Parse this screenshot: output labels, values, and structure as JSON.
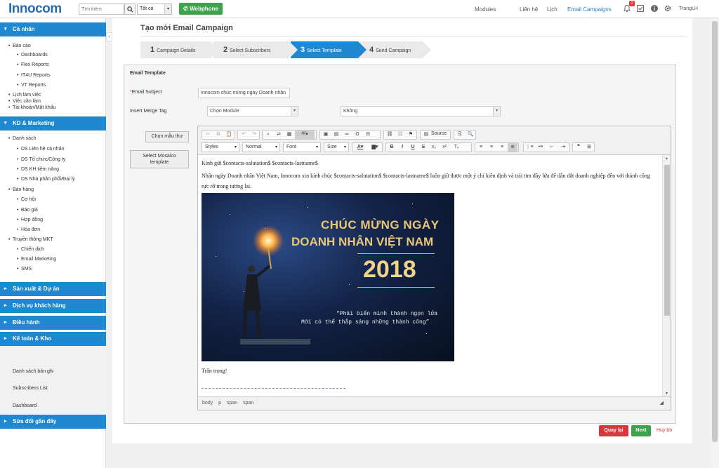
{
  "topbar": {
    "logo": "Innocom",
    "search_placeholder": "Tìm kiếm",
    "scope": "Tất cả",
    "webphone": "Webphone",
    "nav": [
      "Modules",
      "Liên hệ",
      "Lịch",
      "Email Campaigns"
    ],
    "notification_count": "2",
    "username": "TrangLH"
  },
  "sidebar": {
    "sections": [
      "Cá nhân",
      "KD & Marketing",
      "Sản xuất & Dự án",
      "Dịch vụ khách hàng",
      "Điều hành",
      "Kế toán & Kho",
      "Sửa đổi gần đây"
    ],
    "canhan": {
      "baocao": "Báo cáo",
      "reports": [
        "Dashboards",
        "Flex Reports",
        "IT4U Reports",
        "VT Reports"
      ],
      "others": [
        "Lịch làm việc",
        "Việc cần làm",
        "Tài khoản/Mật khẩu"
      ]
    },
    "kd": {
      "danhsach": "Danh sách",
      "danhsach_items": [
        "DS Liên hệ cá nhân",
        "DS Tổ chức/Công ty",
        "DS KH tiềm năng",
        "DS Nhà phân phối/Đại lý"
      ],
      "banhang": "Bán hàng",
      "banhang_items": [
        "Cơ hội",
        "Báo giá",
        "Hợp đồng",
        "Hóa đơn"
      ],
      "truyenthong": "Truyền thông MKT",
      "truyenthong_items": [
        "Chiến dịch",
        "Email Marketing",
        "SMS"
      ]
    },
    "links": [
      "Danh sách bản ghi",
      "Subscribers List",
      "Dashboard"
    ]
  },
  "main": {
    "title": "Tạo mới Email Campaign",
    "steps": [
      {
        "num": "1",
        "label": "Campaign Details"
      },
      {
        "num": "2",
        "label": "Select Subscribers"
      },
      {
        "num": "3",
        "label": "Select Template"
      },
      {
        "num": "4",
        "label": "Send Campaign"
      }
    ],
    "section_label": "Email Template",
    "subject_label": "Email Subject",
    "subject_value": "Innocom chúc mừng ngày Doanh nhân",
    "merge_label": "Insert Merge Tag",
    "module_select": "Chọn Module",
    "tag_select": "Không",
    "choose_template": "Chọn mẫu thư",
    "mosaico_line1": "Select Mosaico",
    "mosaico_line2": "template",
    "editor": {
      "source_label": "Source",
      "styles": "Styles",
      "format": "Normal",
      "font": "Font",
      "size": "Size",
      "greeting": "Kính gửi $contacts-salutation$ $contacts-lastname$",
      "body": "Nhân ngày Doanh nhân Việt Nam, Innocom xin kính chúc $contacts-salutation$ $contacts-lastname$ luôn giữ được một ý chí kiên định và trái tim đầy lửa để dẫn dắt doanh nghiệp đến với thành công rực rỡ trong tương lai.",
      "banner_line1": "CHÚC MỪNG NGÀY",
      "banner_line2": "DOANH NHÂN VIỆT NAM",
      "banner_year": "2018",
      "banner_quote1": "“Phải biến mình thành ngọn lửa",
      "banner_quote2": "Mới có thể thắp sáng những thành công”",
      "closing": "Trân trọng!",
      "path": [
        "body",
        "p",
        "span",
        "span"
      ]
    },
    "back_button": "Quay lại",
    "next_button": "Next",
    "cancel": "Hủy bỏ"
  },
  "colors": {
    "accent": "#1e88d2",
    "success": "#3fa34d",
    "danger": "#d9363e"
  }
}
